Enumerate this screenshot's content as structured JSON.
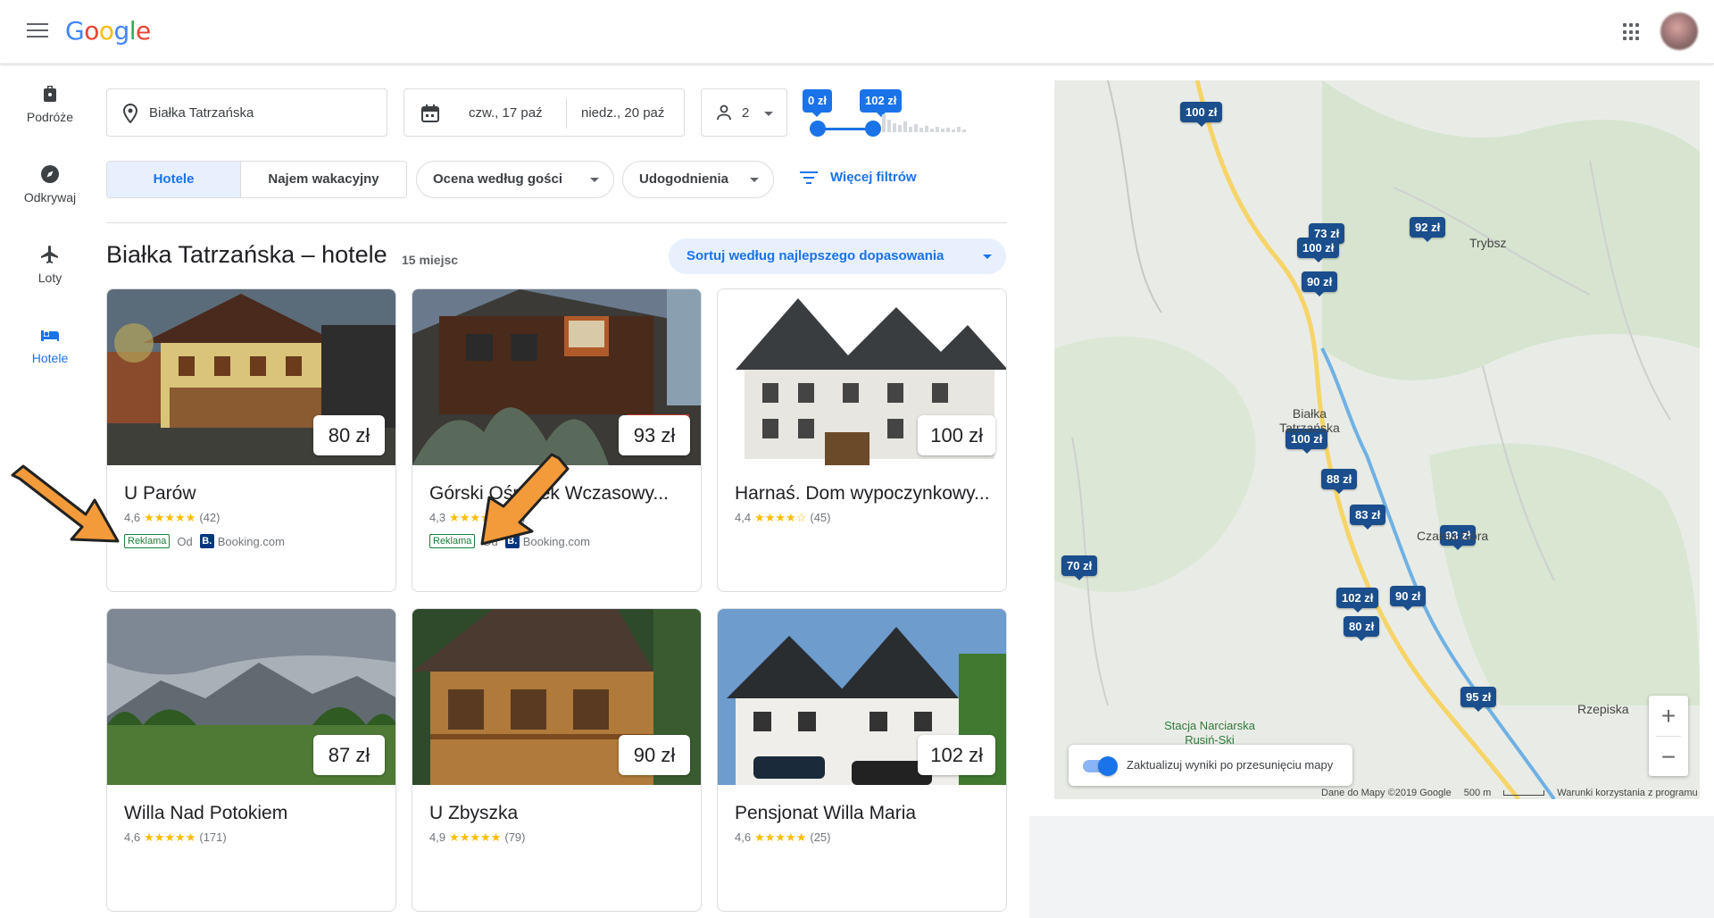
{
  "header": {
    "logo": "Google",
    "menu_icon": "hamburger-menu-icon",
    "apps_icon": "apps-grid-icon"
  },
  "rail": [
    {
      "label": "Podróże",
      "icon": "luggage-icon"
    },
    {
      "label": "Odkrywaj",
      "icon": "compass-icon"
    },
    {
      "label": "Loty",
      "icon": "plane-icon"
    },
    {
      "label": "Hotele",
      "icon": "bed-icon",
      "active": true
    }
  ],
  "search": {
    "location": "Białka Tatrzańska",
    "checkin": "czw., 17 paź",
    "checkout": "niedz., 20 paź",
    "guests": "2",
    "price_min": "0 zł",
    "price_max": "102 zł"
  },
  "filters": {
    "tab_hotels": "Hotele",
    "tab_vacation": "Najem wakacyjny",
    "guest_rating": "Ocena według gości",
    "amenities": "Udogodnienia",
    "more_filters": "Więcej filtrów"
  },
  "results": {
    "title": "Białka Tatrzańska – hotele",
    "count": "15 miejsc",
    "sort": "Sortuj według najlepszego dopasowania"
  },
  "hotels": [
    {
      "name": "U Parów",
      "price": "80 zł",
      "rating": "4,6",
      "stars": "★★★★★",
      "reviews": "(42)",
      "ad": "Reklama",
      "from": "Od",
      "provider": "Booking.com"
    },
    {
      "name": "Górski Ośrodek Wczasowy...",
      "price": "93 zł",
      "rating": "4,3",
      "stars": "★★★★☆",
      "reviews": "(56)",
      "ad": "Reklama",
      "from": "Od",
      "provider": "Booking.com"
    },
    {
      "name": "Harnaś. Dom wypoczynkowy...",
      "price": "100 zł",
      "rating": "4,4",
      "stars": "★★★★☆",
      "reviews": "(45)"
    },
    {
      "name": "Willa Nad Potokiem",
      "price": "87 zł",
      "rating": "4,6",
      "stars": "★★★★★",
      "reviews": "(171)"
    },
    {
      "name": "U Zbyszka",
      "price": "90 zł",
      "rating": "4,9",
      "stars": "★★★★★",
      "reviews": "(79)"
    },
    {
      "name": "Pensjonat Willa Maria",
      "price": "102 zł",
      "rating": "4,6",
      "stars": "★★★★★",
      "reviews": "(25)"
    }
  ],
  "map": {
    "pins": [
      "100 zł",
      "92 zł",
      "73 zł",
      "100 zł",
      "90 zł",
      "100 zł",
      "88 zł",
      "83 zł",
      "93 zł",
      "70 zł",
      "102 zł",
      "90 zł",
      "80 zł",
      "95 zł"
    ],
    "towns": [
      "Trybsz",
      "Białka Tatrzańska",
      "Czarna Góra",
      "Rzepiska",
      "Stacja Narciarska Rusiń-Ski"
    ],
    "toggle_label": "Zaktualizuj wyniki po przesunięciu mapy",
    "attribution": "Dane do Mapy ©2019 Google",
    "scale": "500 m",
    "terms": "Warunki korzystania z programu"
  }
}
